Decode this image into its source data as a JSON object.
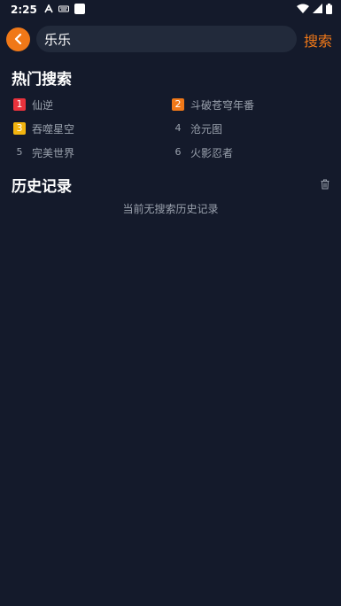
{
  "status_bar": {
    "time": "2:25",
    "left_icons": [
      "font-icon",
      "keyboard-icon",
      "square-app-icon"
    ],
    "right_icons": [
      "wifi-icon",
      "signal-icon",
      "battery-icon"
    ]
  },
  "search": {
    "back_icon": "chevron-left-icon",
    "value": "乐乐",
    "submit_label": "搜索"
  },
  "hot_search": {
    "title": "热门搜索",
    "items": [
      {
        "rank": "1",
        "label": "仙逆",
        "rank_color": "#e8323c"
      },
      {
        "rank": "2",
        "label": "斗破苍穹年番",
        "rank_color": "#f07818"
      },
      {
        "rank": "3",
        "label": "吞噬星空",
        "rank_color": "#f2b40f"
      },
      {
        "rank": "4",
        "label": "沧元图",
        "rank_color": ""
      },
      {
        "rank": "5",
        "label": "完美世界",
        "rank_color": ""
      },
      {
        "rank": "6",
        "label": "火影忍者",
        "rank_color": ""
      }
    ]
  },
  "history": {
    "title": "历史记录",
    "clear_icon": "trash-icon",
    "empty_text": "当前无搜索历史记录"
  },
  "colors": {
    "background": "#141a2b",
    "accent": "#f07818",
    "search_box": "#222a3b",
    "muted_text": "#9aa1ad"
  }
}
